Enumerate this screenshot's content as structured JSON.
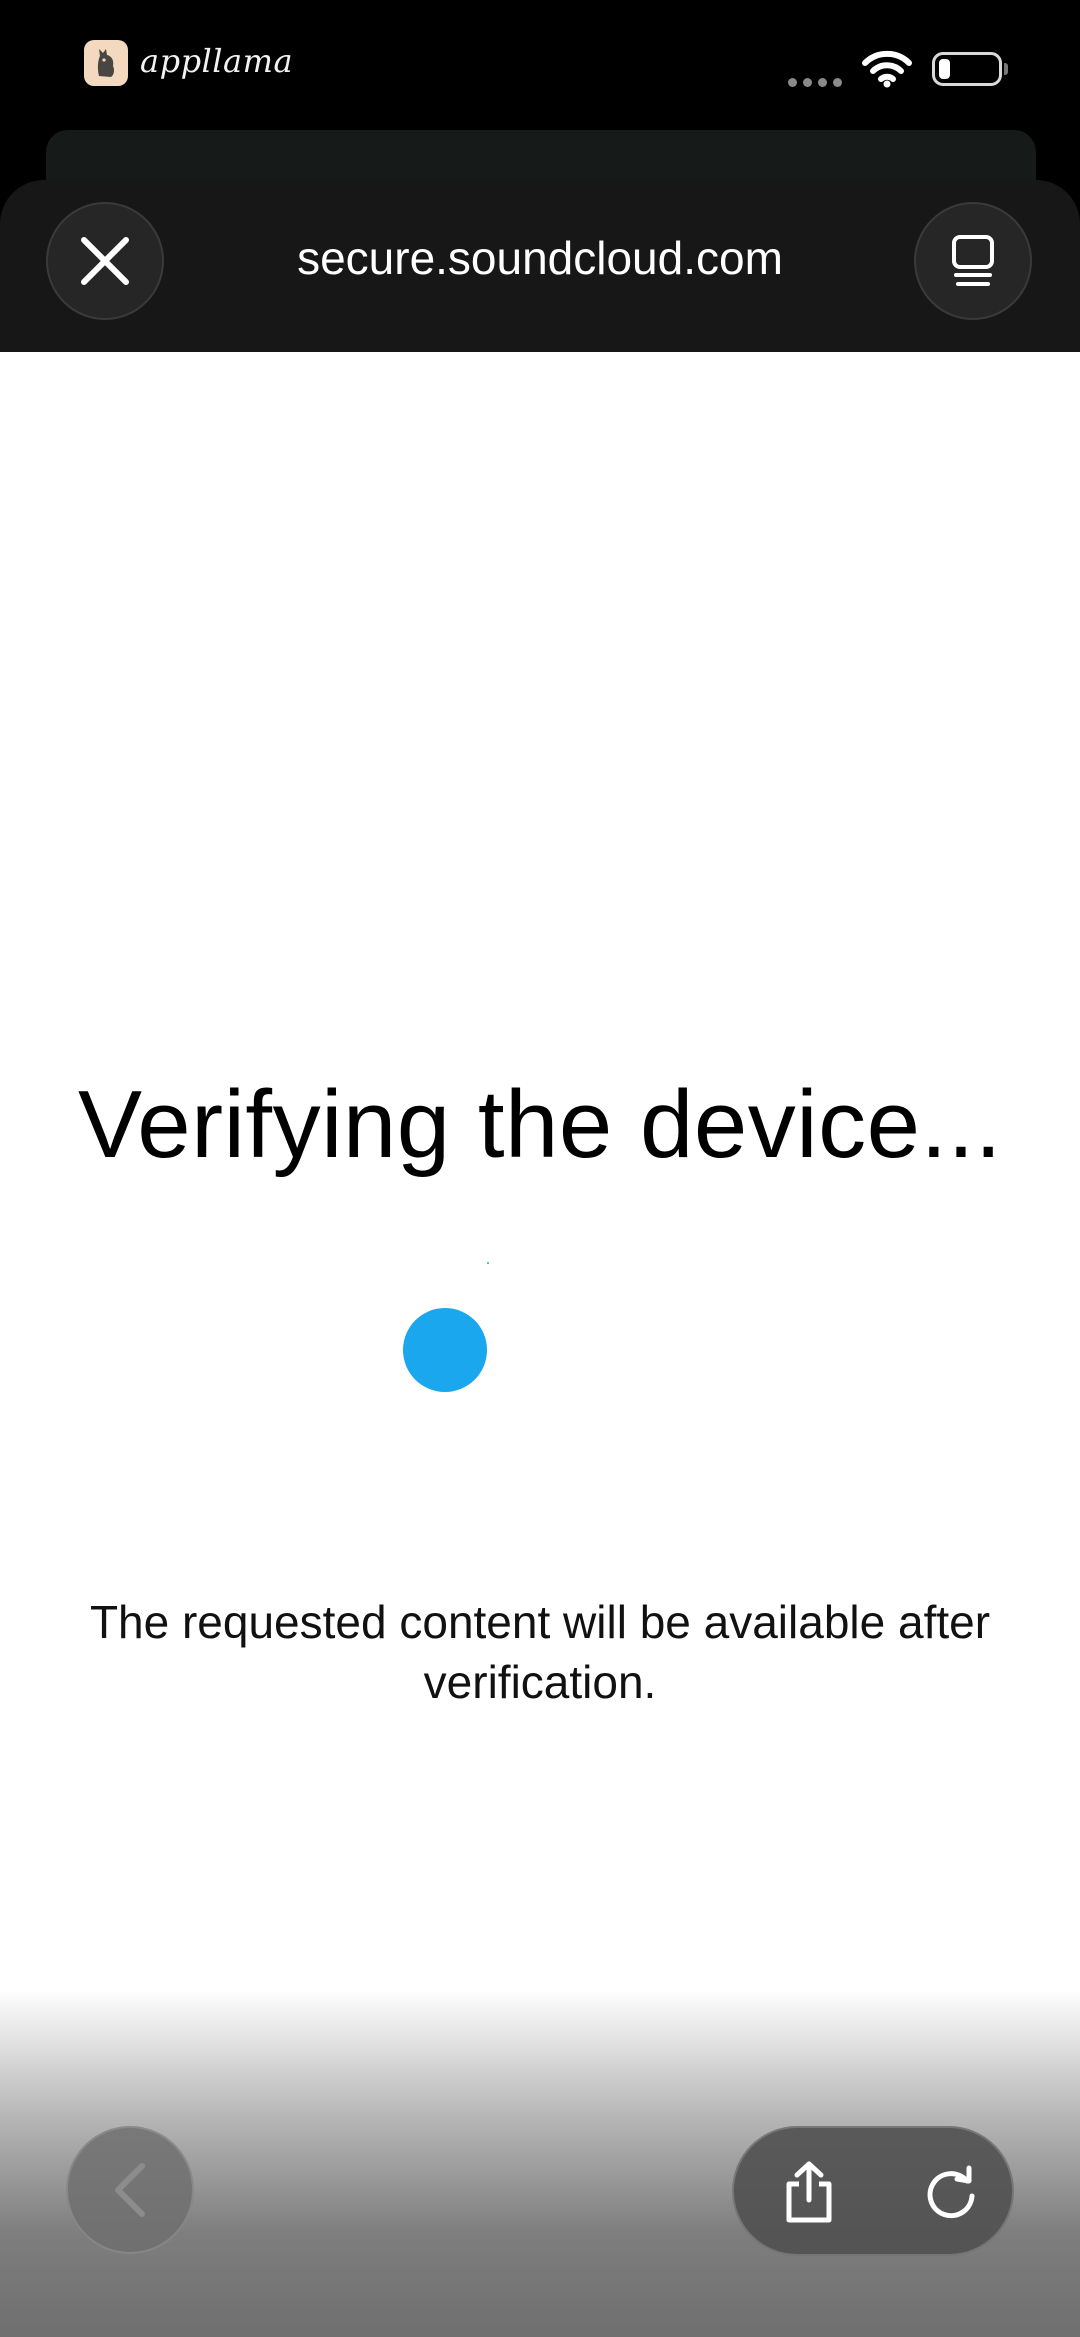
{
  "status_bar": {
    "carrier": "appllama",
    "icons": [
      "appllama-logo-icon",
      "signal-icon",
      "wifi-icon",
      "battery-icon"
    ]
  },
  "browser": {
    "url": "secure.soundcloud.com",
    "close_icon": "close-icon",
    "tabs_icon": "tabs-icon"
  },
  "content": {
    "title": "Verifying the device...",
    "message": "The requested content will be available after verification.",
    "spinner_color": "#1aa7ee"
  },
  "toolbar": {
    "back_icon": "chevron-left-icon",
    "share_icon": "share-icon",
    "reload_icon": "reload-icon"
  }
}
